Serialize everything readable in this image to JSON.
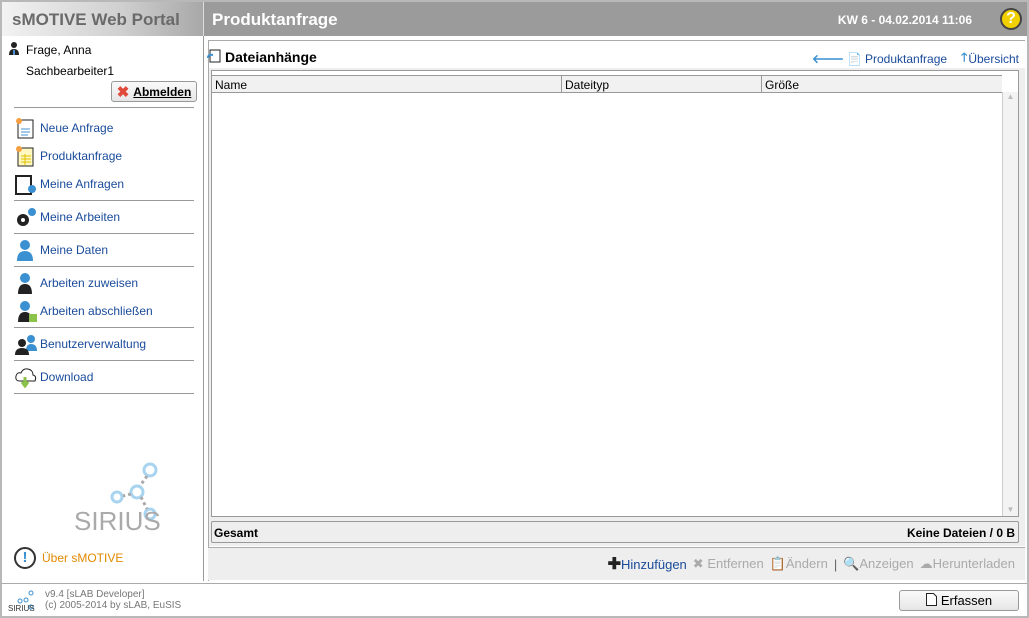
{
  "app": {
    "title": "sMOTIVE Web Portal",
    "page_title": "Produktanfrage",
    "datetime": "KW 6 - 04.02.2014 11:06",
    "help_icon": "help-icon"
  },
  "user": {
    "name": "Frage, Anna",
    "role": "Sachbearbeiter1",
    "logout": "Abmelden"
  },
  "nav": [
    {
      "label": "Neue Anfrage",
      "icon": "new-document-icon"
    },
    {
      "label": "Produktanfrage",
      "icon": "product-request-icon"
    },
    {
      "label": "Meine Anfragen",
      "icon": "my-requests-icon"
    },
    {
      "label": "Meine Arbeiten",
      "icon": "gears-icon"
    },
    {
      "label": "Meine Daten",
      "icon": "user-icon"
    },
    {
      "label": "Arbeiten zuweisen",
      "icon": "worker-icon"
    },
    {
      "label": "Arbeiten abschließen",
      "icon": "worker-done-icon"
    },
    {
      "label": "Benutzerverwaltung",
      "icon": "users-icon"
    },
    {
      "label": "Download",
      "icon": "cloud-download-icon"
    }
  ],
  "about": "Über sMOTIVE",
  "logo_text": "SIRIUS",
  "section": {
    "title": "Dateianhänge",
    "back_link": "Produktanfrage",
    "up_link": "Übersicht"
  },
  "table": {
    "columns": [
      "Name",
      "Dateityp",
      "Größe"
    ],
    "rows": []
  },
  "total": {
    "label": "Gesamt",
    "value": "Keine Dateien / 0 B"
  },
  "actions": {
    "add": "Hinzufügen",
    "remove": "Entfernen",
    "edit": "Ändern",
    "view": "Anzeigen",
    "download": "Herunterladen"
  },
  "footer": {
    "version": "v9.4 [sLAB Developer]",
    "copyright": "(c) 2005-2014 by sLAB, EuSIS",
    "submit": "Erfassen"
  },
  "colors": {
    "link": "#1a4b9a",
    "header": "#9b9b9b",
    "about": "#e08a00"
  }
}
